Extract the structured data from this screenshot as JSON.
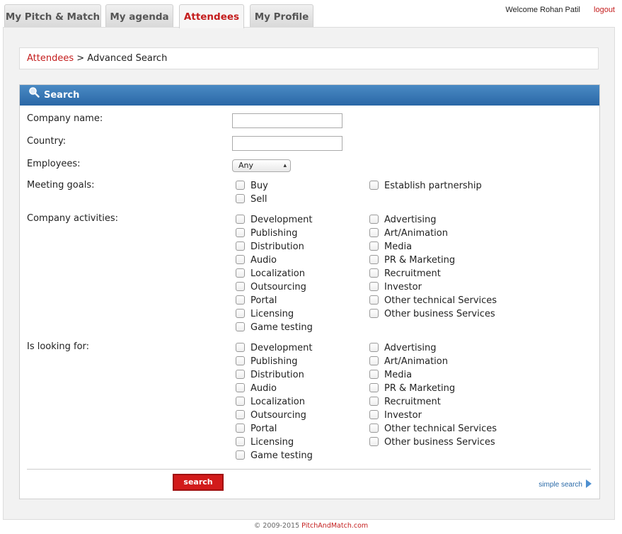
{
  "tabs": [
    "My Pitch & Match",
    "My agenda",
    "Attendees",
    "My Profile"
  ],
  "active_tab": 2,
  "header": {
    "welcome": "Welcome Rohan Patil",
    "logout": "logout"
  },
  "breadcrumb": {
    "link": "Attendees",
    "sep": " > ",
    "current": "Advanced Search"
  },
  "search": {
    "title": "Search",
    "company_label": "Company name:",
    "country_label": "Country:",
    "employees_label": "Employees:",
    "employees_value": "Any",
    "goals_label": "Meeting goals:",
    "goals": [
      "Buy",
      "Sell",
      "Establish partnership"
    ],
    "activities_label": "Company activities:",
    "looking_label": "Is looking for:",
    "options_left": [
      "Development",
      "Publishing",
      "Distribution",
      "Audio",
      "Localization",
      "Outsourcing",
      "Portal",
      "Licensing",
      "Game testing"
    ],
    "options_right": [
      "Advertising",
      "Art/Animation",
      "Media",
      "PR & Marketing",
      "Recruitment",
      "Investor",
      "Other technical Services",
      "Other business Services"
    ],
    "button": "search",
    "simple_link": "simple search"
  },
  "footer": {
    "copyright": "© 2009-2015 ",
    "site": "PitchAndMatch.com"
  },
  "colors": {
    "accent": "#c41d1d",
    "header_blue": "#2a67a6",
    "button_red": "#d21a1a"
  }
}
